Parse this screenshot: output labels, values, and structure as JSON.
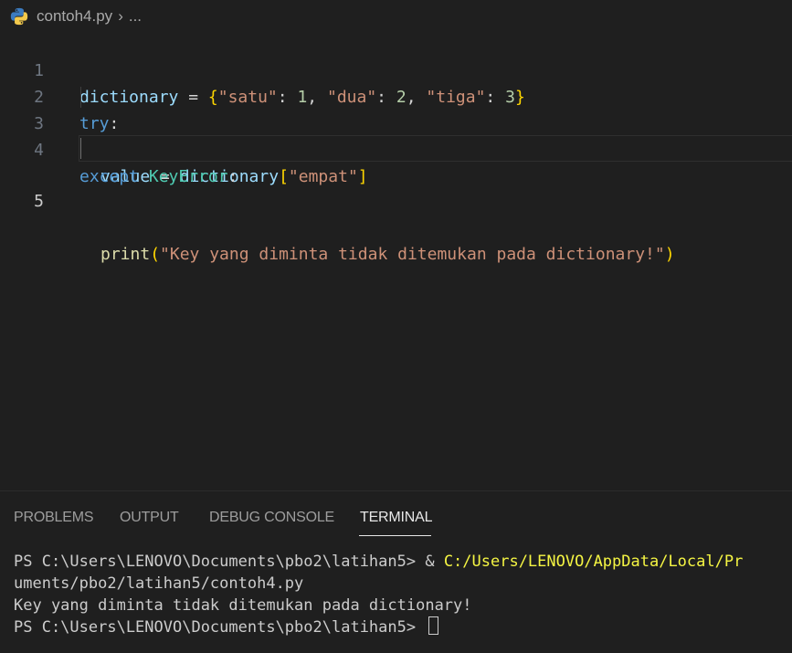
{
  "breadcrumb": {
    "file": "contoh4.py",
    "more": "..."
  },
  "editor": {
    "line_numbers": [
      "1",
      "2",
      "3",
      "4",
      "5"
    ],
    "lines": [
      {
        "tokens": [
          "dictionary",
          " = ",
          "{",
          "\"satu\"",
          ": ",
          "1",
          ", ",
          "\"dua\"",
          ": ",
          "2",
          ", ",
          "\"tiga\"",
          ": ",
          "3",
          "}"
        ]
      },
      {
        "tokens": [
          "try",
          ":"
        ]
      },
      {
        "tokens": [
          "value",
          " = ",
          "dictionary",
          "[",
          "\"empat\"",
          "]"
        ]
      },
      {
        "tokens": [
          "except",
          " ",
          "KeyError",
          ":"
        ]
      },
      {
        "tokens": [
          "print",
          "(",
          "\"Key yang diminta tidak ditemukan pada dictionary!\"",
          ")"
        ]
      }
    ]
  },
  "panel": {
    "tabs": [
      "PROBLEMS",
      "OUTPUT",
      "DEBUG CONSOLE",
      "TERMINAL"
    ],
    "active_tab": "TERMINAL"
  },
  "terminal": {
    "line1_prompt": "PS C:\\Users\\LENOVO\\Documents\\pbo2\\latihan5> & ",
    "line1_path": "C:/Users/LENOVO/AppData/Local/Pr",
    "line2": "uments/pbo2/latihan5/contoh4.py",
    "line3": "Key yang diminta tidak ditemukan pada dictionary!",
    "line4_prompt": "PS C:\\Users\\LENOVO\\Documents\\pbo2\\latihan5> "
  },
  "colors": {
    "background": "#1f1f1f",
    "keyword": "#569cd6",
    "string": "#ce9178",
    "number": "#b5cea8",
    "variable": "#9cdcfe",
    "class": "#4ec9b0",
    "function": "#dcdcaa",
    "bracket_gold": "#ffd700",
    "bracket_purple": "#da70d6",
    "terminal_path": "#f5f543"
  }
}
